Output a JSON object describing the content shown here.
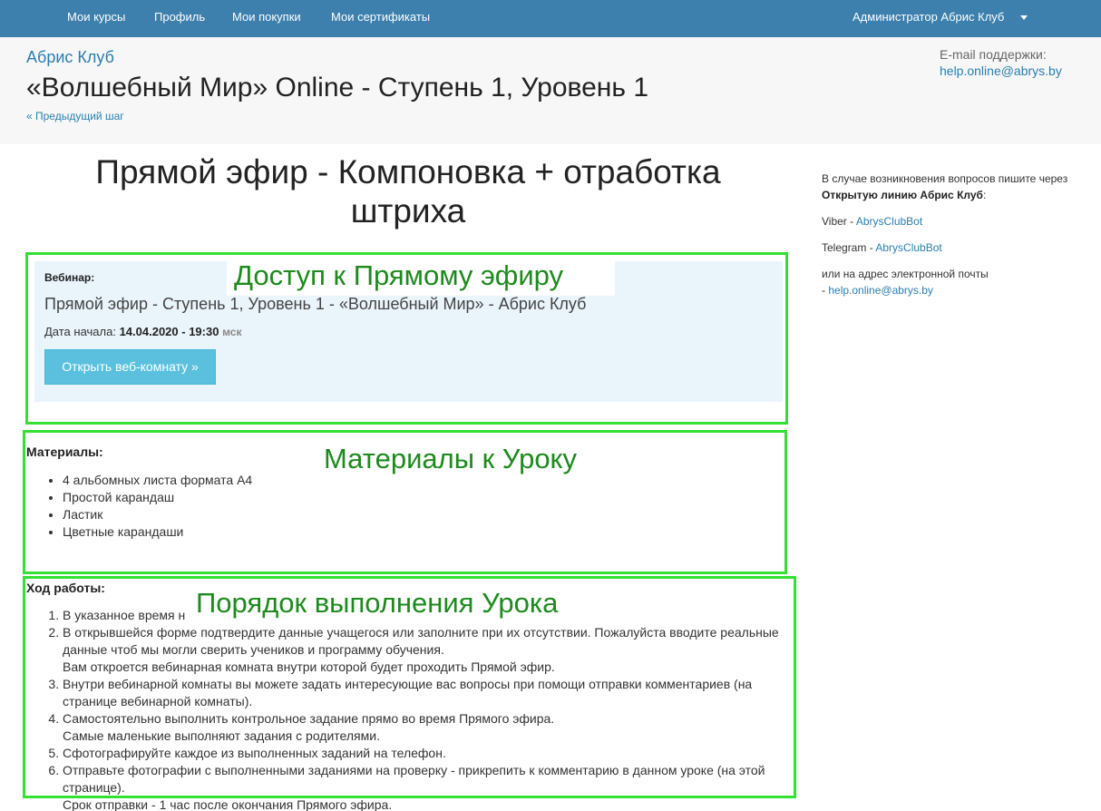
{
  "nav": {
    "items": [
      "Мои курсы",
      "Профиль",
      "Мои покупки",
      "Мои сертификаты"
    ],
    "user": "Администратор Абрис Клуб"
  },
  "header": {
    "club": "Абрис Клуб",
    "course_title": "«Волшебный Мир» Online - Ступень 1, Уровень 1",
    "prev_step": "« Предыдущий шаг",
    "support_label": "E-mail поддержки:",
    "support_email": "help.online@abrys.by"
  },
  "lesson": {
    "title": "Прямой эфир - Компоновка + отработка штриха"
  },
  "annotations": {
    "access": "Доступ к Прямому эфиру",
    "materials": "Материалы к Уроку",
    "order": "Порядок выполнения Урока"
  },
  "webinar": {
    "label": "Вебинар:",
    "name": "Прямой эфир - Ступень 1, Уровень 1 - «Волшебный Мир» - Абрис Клуб",
    "start_label": "Дата начала:",
    "start_value": "14.04.2020 - 19:30",
    "timezone": "мск",
    "open_button": "Открыть веб-комнату »"
  },
  "materials": {
    "heading": "Материалы:",
    "items": [
      "4 альбомных листа формата А4",
      "Простой карандаш",
      "Ластик",
      "Цветные карандаши"
    ]
  },
  "steps": {
    "heading": "Ход работы:",
    "items": [
      [
        "В указанное время н"
      ],
      [
        "В открывшейся форме подтвердите данные учащегося или заполните при их отсутствии. Пожалуйста вводите реальные данные чтоб мы могли сверить учеников и программу обучения.",
        "Вам откроется вебинарная комната внутри которой будет проходить Прямой эфир."
      ],
      [
        "Внутри вебинарной комнаты вы можете задать интересующие вас вопросы при помощи отправки комментариев (на странице вебинарной комнаты)."
      ],
      [
        "Самостоятельно выполнить контрольное задание прямо во время Прямого эфира.",
        "Самые маленькие выполняют задания с родителями."
      ],
      [
        "Сфотографируйте каждое из выполненных заданий на телефон."
      ],
      [
        "Отправьте фотографии с выполненными заданиями на проверку - прикрепить к комментарию в данном уроке (на этой странице).",
        "Срок отправки - 1 час после окончания Прямого эфира."
      ]
    ]
  },
  "sidebar": {
    "intro": "В случае возникновения вопросов пишите через",
    "line_name": "Открытую линию Абрис Клуб",
    "viber_label": "Viber - ",
    "viber_link": "AbrysClubBot",
    "telegram_label": "Telegram - ",
    "telegram_link": "AbrysClubBot",
    "email_intro": "или на адрес электронной почты",
    "email_prefix": "- ",
    "email_link": "help.online@abrys.by"
  },
  "colors": {
    "navbar": "#3d7fad",
    "link": "#2a7fb0",
    "button": "#5bc0de",
    "annotation": "#33e033",
    "annotation_text": "#1d8a1d"
  }
}
